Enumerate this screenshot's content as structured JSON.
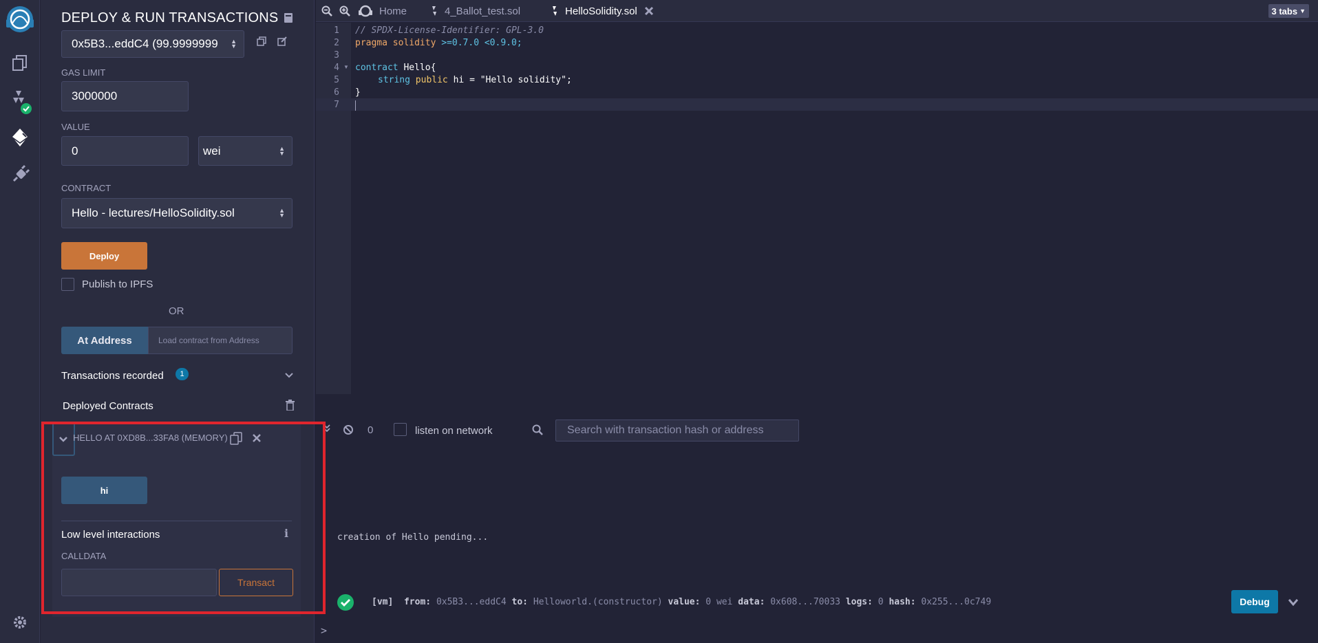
{
  "panel": {
    "title": "DEPLOY & RUN TRANSACTIONS",
    "account_value": "0x5B3...eddC4 (99.9999999",
    "gas_limit_label": "GAS LIMIT",
    "gas_limit_value": "3000000",
    "value_label": "VALUE",
    "value_value": "0",
    "value_unit": "wei",
    "contract_label": "CONTRACT",
    "contract_value": "Hello - lectures/HelloSolidity.sol",
    "deploy_label": "Deploy",
    "publish_label": "Publish to IPFS",
    "or_label": "OR",
    "at_address_label": "At Address",
    "at_address_placeholder": "Load contract from Address",
    "tx_recorded_label": "Transactions recorded",
    "tx_recorded_count": "1",
    "deployed_label": "Deployed Contracts",
    "instance_title": "HELLO AT 0XD8B...33FA8 (MEMORY)",
    "hi_button": "hi",
    "low_level_label": "Low level interactions",
    "calldata_label": "CALLDATA",
    "transact_label": "Transact"
  },
  "tabs": {
    "home": "Home",
    "ballot": "4_Ballot_test.sol",
    "hello": "HelloSolidity.sol",
    "count": "3 tabs"
  },
  "editor": {
    "lines": [
      "1",
      "2",
      "3",
      "4",
      "5",
      "6",
      "7"
    ],
    "code": {
      "l1": "// SPDX-License-Identifier: GPL-3.0",
      "l2_kw": "pragma solidity",
      "l2_rest": " >=0.7.0 <0.9.0;",
      "l4_kw": "contract",
      "l4_rest": " Hello{",
      "l5_type": "string",
      "l5_mod": "public",
      "l5_name": " hi = ",
      "l5_str": "\"Hello solidity\"",
      "l5_end": ";",
      "l6": "}"
    }
  },
  "terminal": {
    "pending_count": "0",
    "listen_label": "listen on network",
    "search_placeholder": "Search with transaction hash or address",
    "pending_msg": "creation of Hello pending...",
    "log": {
      "vm": "[vm]",
      "from_k": "from:",
      "from_v": "0x5B3...eddC4",
      "to_k": "to:",
      "to_v": "Helloworld.(constructor)",
      "value_k": "value:",
      "value_v": "0 wei",
      "data_k": "data:",
      "data_v": "0x608...70033",
      "logs_k": "logs:",
      "logs_v": "0",
      "hash_k": "hash:",
      "hash_v": "0x255...0c749"
    },
    "debug_label": "Debug",
    "prompt": ">"
  },
  "colors": {
    "deploy": "#c97539",
    "hi_button": "#35587a",
    "at_address": "#35587a",
    "debug": "#0e78a7",
    "badge": "#0e78a7",
    "success": "#1ab26b",
    "highlight": "#e0252d"
  }
}
